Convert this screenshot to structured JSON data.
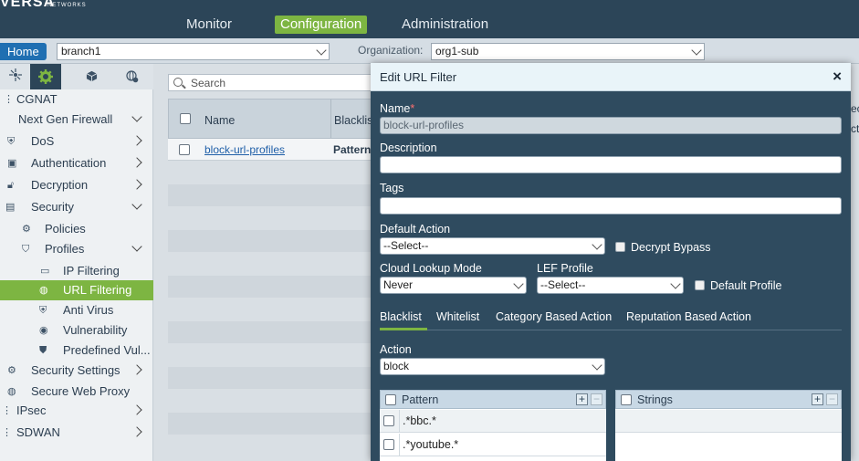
{
  "header": {
    "logo_text": "VERSA",
    "logo_sub": "NETWORKS",
    "nav": {
      "monitor": "Monitor",
      "configuration": "Configuration",
      "administration": "Administration"
    },
    "accent_color": "#7db542"
  },
  "context_bar": {
    "home_label": "Home",
    "appliance_value": "branch1",
    "organization_label": "Organization:",
    "organization_value": "org1-sub"
  },
  "sidebar": {
    "tabs": [
      "network-icon",
      "gear-icon",
      "cube-icon",
      "globe-gear-icon"
    ],
    "items": [
      {
        "label": "CGNAT"
      },
      {
        "label": "Next Gen Firewall"
      },
      {
        "label": "DoS"
      },
      {
        "label": "Authentication"
      },
      {
        "label": "Decryption"
      },
      {
        "label": "Security"
      },
      {
        "label": "Policies"
      },
      {
        "label": "Profiles"
      },
      {
        "label": "IP Filtering"
      },
      {
        "label": "URL Filtering"
      },
      {
        "label": "Anti Virus"
      },
      {
        "label": "Vulnerability"
      },
      {
        "label": "Predefined Vul..."
      },
      {
        "label": "Security Settings"
      },
      {
        "label": "Secure Web Proxy"
      },
      {
        "label": "IPsec"
      },
      {
        "label": "SDWAN"
      }
    ]
  },
  "list": {
    "search_placeholder": "Search",
    "columns": {
      "name": "Name",
      "blacklist": "Blacklis"
    },
    "rows": [
      {
        "name": "block-url-profiles",
        "blacklist": "Pattern"
      }
    ],
    "right_edge_text_1": "ec",
    "right_edge_text_2": "cti"
  },
  "dialog": {
    "title": "Edit URL Filter",
    "close_glyph": "×",
    "name_label": "Name",
    "required_mark": "*",
    "name_value": "block-url-profiles",
    "description_label": "Description",
    "description_value": "",
    "tags_label": "Tags",
    "tags_value": "",
    "default_action_label": "Default Action",
    "default_action_value": "--Select--",
    "decrypt_bypass_label": "Decrypt Bypass",
    "cloud_lookup_label": "Cloud Lookup Mode",
    "cloud_lookup_value": "Never",
    "lef_profile_label": "LEF Profile",
    "lef_profile_value": "--Select--",
    "default_profile_label": "Default Profile",
    "tabs": {
      "blacklist": "Blacklist",
      "whitelist": "Whitelist",
      "category": "Category Based Action",
      "reputation": "Reputation Based Action"
    },
    "action_label": "Action",
    "action_value": "block",
    "pattern_grid": {
      "header": "Pattern",
      "rows": [
        ".*bbc.*",
        ".*youtube.*"
      ]
    },
    "strings_grid": {
      "header": "Strings"
    },
    "plus": "+",
    "minus": "−"
  }
}
